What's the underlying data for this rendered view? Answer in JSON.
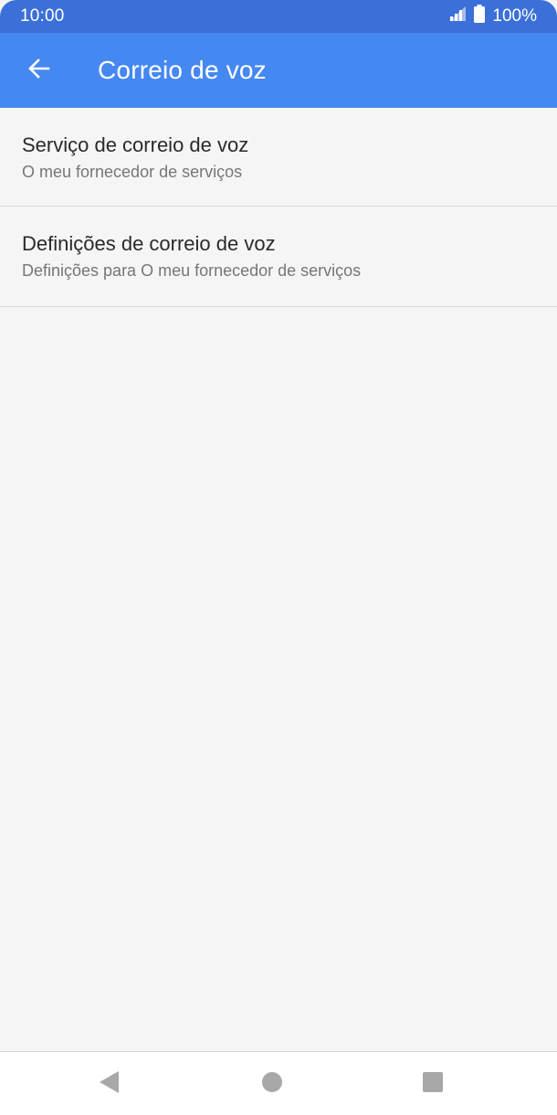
{
  "status_bar": {
    "time": "10:00",
    "battery_text": "100%",
    "icons": [
      "signal-icon",
      "battery-icon"
    ]
  },
  "app_bar": {
    "title": "Correio de voz",
    "back_icon": "arrow-left-icon"
  },
  "settings": {
    "items": [
      {
        "title": "Serviço de correio de voz",
        "subtitle": "O meu fornecedor de serviços"
      },
      {
        "title": "Definições de correio de voz",
        "subtitle": "Definições para O meu fornecedor de serviços"
      }
    ]
  },
  "nav_bar": {
    "icons": [
      "nav-back-icon",
      "nav-home-icon",
      "nav-recents-icon"
    ]
  },
  "colors": {
    "status_bar": "#3a70d8",
    "app_bar": "#4688f1",
    "background": "#f5f5f5",
    "divider": "#d9d9d9",
    "nav_icon": "#a8a8a8"
  }
}
